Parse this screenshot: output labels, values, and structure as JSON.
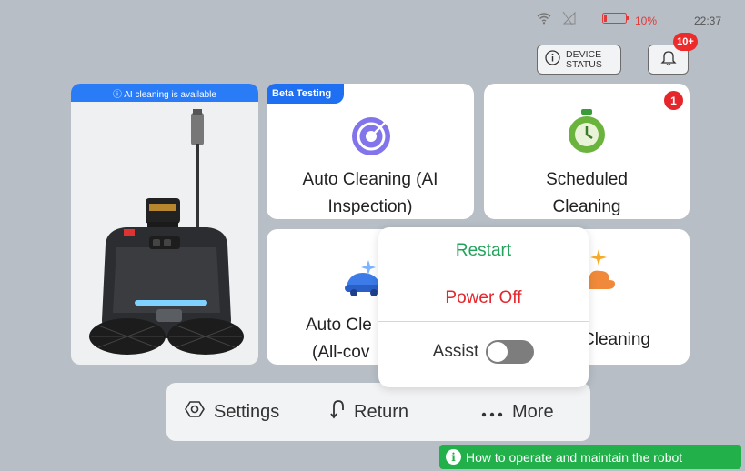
{
  "status_bar": {
    "battery_percent": "10%",
    "time": "22:37",
    "icons": [
      "wifi-icon",
      "signal-icon",
      "battery-low-icon"
    ],
    "battery_color": "#e23a3a"
  },
  "header": {
    "device_status_line1": "DEVICE",
    "device_status_line2": "STATUS",
    "notifications_badge": "10+"
  },
  "robot_card": {
    "banner": "ⓘ AI cleaning is available"
  },
  "cards": {
    "auto_ai": {
      "tag": "Beta Testing",
      "title_line1": "Auto Cleaning (AI",
      "title_line2": "Inspection)",
      "icon": "target-icon"
    },
    "scheduled": {
      "badge": "1",
      "title_line1": "Scheduled",
      "title_line2": "Cleaning",
      "icon": "stopwatch-icon"
    },
    "auto_full": {
      "title_line1": "Auto Cle",
      "title_line2": "(All-cov",
      "icon": "car-sparkle-icon"
    },
    "spot": {
      "title": "Cleaning",
      "icon": "cloud-sparkle-icon"
    }
  },
  "popup": {
    "restart": "Restart",
    "power_off": "Power Off",
    "assist": "Assist",
    "assist_on": false
  },
  "bottom_bar": {
    "settings": "Settings",
    "return": "Return",
    "more": "More"
  },
  "help": {
    "label": "How to operate and maintain the robot"
  },
  "colors": {
    "accent_blue": "#1e6ff2",
    "restart_green": "#22a35a",
    "power_off_red": "#e5262b",
    "help_green": "#22b04b"
  }
}
